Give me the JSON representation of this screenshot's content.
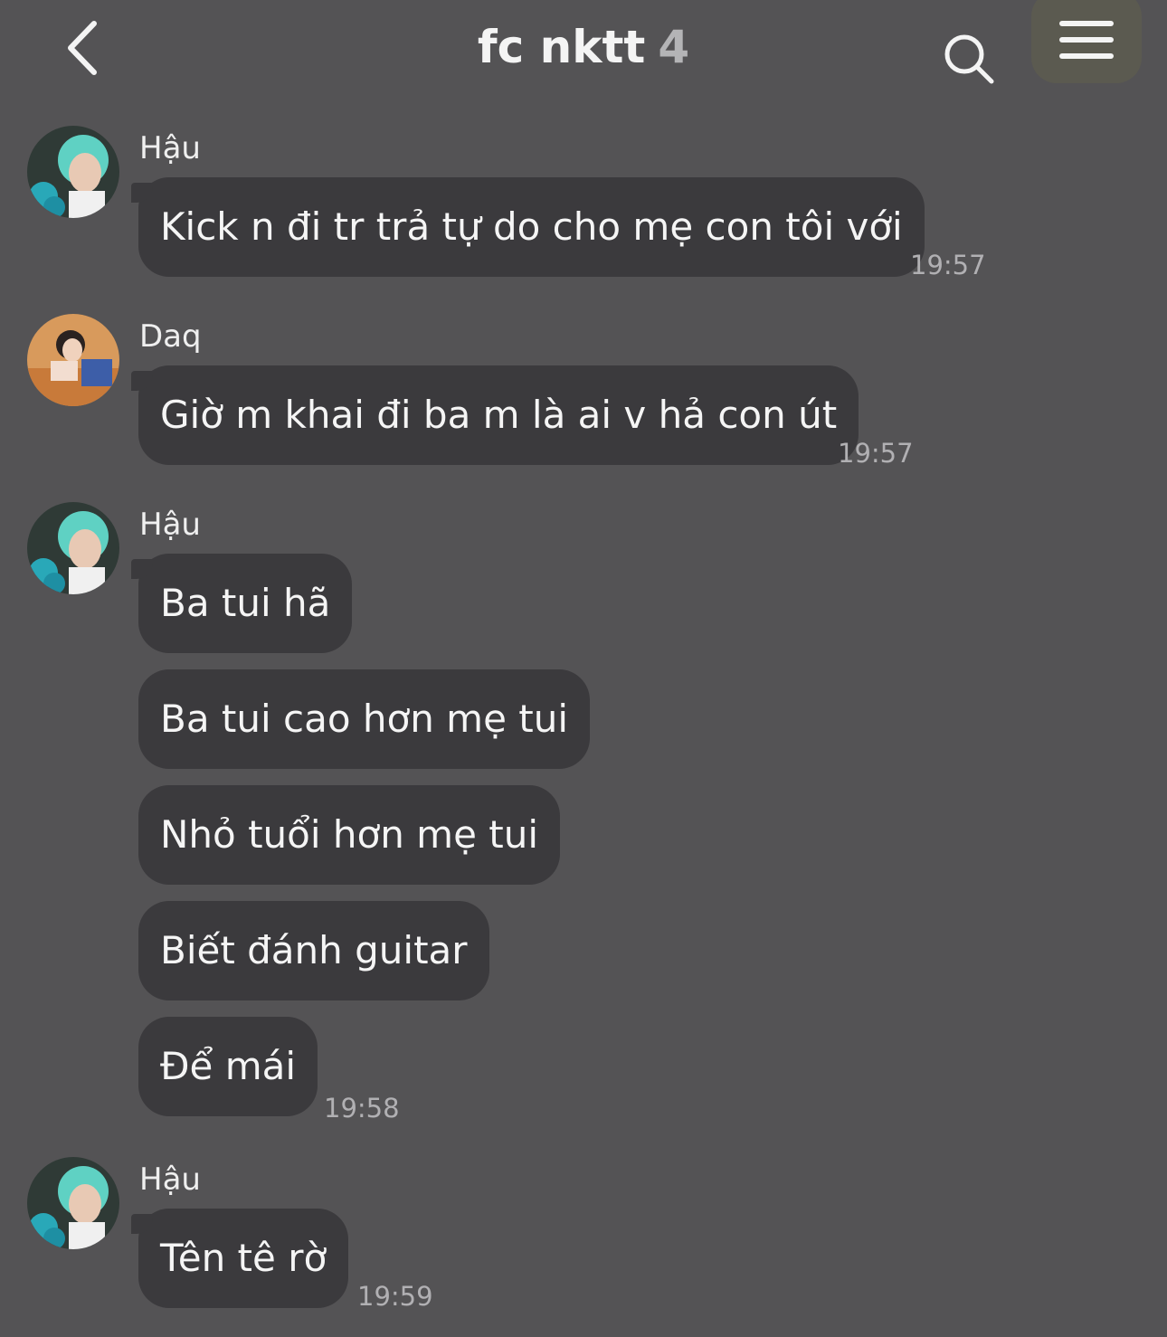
{
  "header": {
    "back_icon": "chevron-left-icon",
    "title": "fc nktt",
    "member_count": "4",
    "search_icon": "search-icon",
    "menu_icon": "hamburger-menu-icon"
  },
  "messages": [
    {
      "sender": "Hậu",
      "avatar": "avatar-hau",
      "bubbles": [
        "Kick n đi tr trả tự do cho mẹ con tôi với"
      ],
      "time": "19:57"
    },
    {
      "sender": "Daq",
      "avatar": "avatar-daq",
      "bubbles": [
        "Giờ m khai đi ba m là ai v hả con út"
      ],
      "time": "19:57"
    },
    {
      "sender": "Hậu",
      "avatar": "avatar-hau",
      "bubbles": [
        "Ba tui hã",
        "Ba tui cao hơn mẹ tui",
        "Nhỏ tuổi hơn mẹ tui",
        "Biết đánh guitar",
        "Để mái"
      ],
      "time": "19:58"
    },
    {
      "sender": "Hậu",
      "avatar": "avatar-hau",
      "bubbles": [
        "Tên tê rờ"
      ],
      "time": "19:59"
    }
  ],
  "colors": {
    "background": "#545355",
    "bubble": "#3b3a3d",
    "text": "#f5f5f5",
    "timestamp": "#b1b0b3"
  }
}
